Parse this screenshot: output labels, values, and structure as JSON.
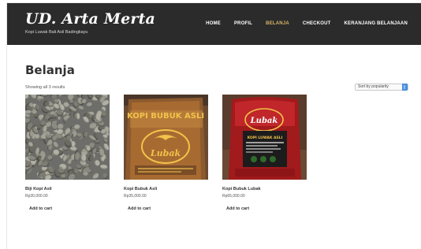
{
  "site": {
    "title": "UD. Arta Merta",
    "tagline": "Kopi Luwak Bali Asli Badingkayu"
  },
  "nav": [
    {
      "label": "HOME",
      "active": false
    },
    {
      "label": "PROFIL",
      "active": false
    },
    {
      "label": "BELANJA",
      "active": true
    },
    {
      "label": "CHECKOUT",
      "active": false
    },
    {
      "label": "KERANJANG BELANJAAN",
      "active": false
    }
  ],
  "colors": {
    "header_bg": "#2b2b2b",
    "active_nav": "#d9b56a",
    "select_accent": "#4a8ee0"
  },
  "page": {
    "title": "Belanja",
    "result_count": "Showing all 3 results",
    "sort_selected": "Sort by popularity"
  },
  "products": [
    {
      "name": "Biji Kopi Asli",
      "price": "Rp30,000.00",
      "cart_label": "Add to cart",
      "image": "green-coffee-beans"
    },
    {
      "name": "Kopi Bubuk Asli",
      "price": "Rp35,000.00",
      "cart_label": "Add to cart",
      "image": "kopi-bubuk-asli-lubak-package"
    },
    {
      "name": "Kopi Bubuk Lubak",
      "price": "Rp65,000.00",
      "cart_label": "Add to cart",
      "image": "kopi-luwak-lubak-red-package"
    }
  ],
  "package_text": {
    "brand": "Lubak",
    "product1_label": "KOPI BUBUK ASLI",
    "product2_label": "KOPI LUWAK ASLI"
  }
}
